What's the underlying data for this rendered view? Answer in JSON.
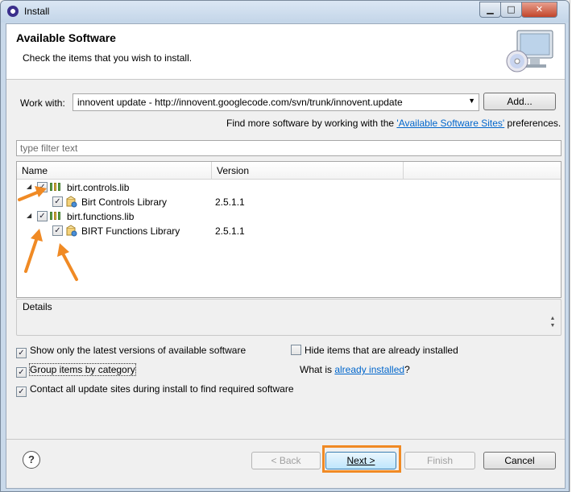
{
  "window": {
    "title": "Install"
  },
  "header": {
    "title": "Available Software",
    "description": "Check the items that you wish to install."
  },
  "work_with": {
    "label": "Work with:",
    "value": "innovent update - http://innovent.googlecode.com/svn/trunk/innovent.update",
    "add_button": "Add...",
    "more_prefix": "Find more software by working with the ",
    "more_link": "'Available Software Sites'",
    "more_suffix": " preferences."
  },
  "filter": {
    "placeholder": "type filter text"
  },
  "tree": {
    "columns": [
      "Name",
      "Version"
    ],
    "rows": [
      {
        "name": "birt.controls.lib",
        "version": "",
        "checked": true,
        "level": 0
      },
      {
        "name": "Birt Controls Library",
        "version": "2.5.1.1",
        "checked": true,
        "level": 1
      },
      {
        "name": "birt.functions.lib",
        "version": "",
        "checked": true,
        "level": 0
      },
      {
        "name": "BIRT Functions Library",
        "version": "2.5.1.1",
        "checked": true,
        "level": 1
      }
    ]
  },
  "details": {
    "label": "Details"
  },
  "options": {
    "show_latest": "Show only the latest versions of available software",
    "hide_installed": "Hide items that are already installed",
    "group_by_category": "Group items by category",
    "what_is": "What is ",
    "already_installed_link": "already installed",
    "what_is_suffix": "?",
    "contact_sites": "Contact all update sites during install to find required software"
  },
  "footer": {
    "help": "?",
    "back": "< Back",
    "next": "Next >",
    "finish": "Finish",
    "cancel": "Cancel"
  },
  "colors": {
    "accent_orange": "#f08a24",
    "link_blue": "#0066cc"
  }
}
